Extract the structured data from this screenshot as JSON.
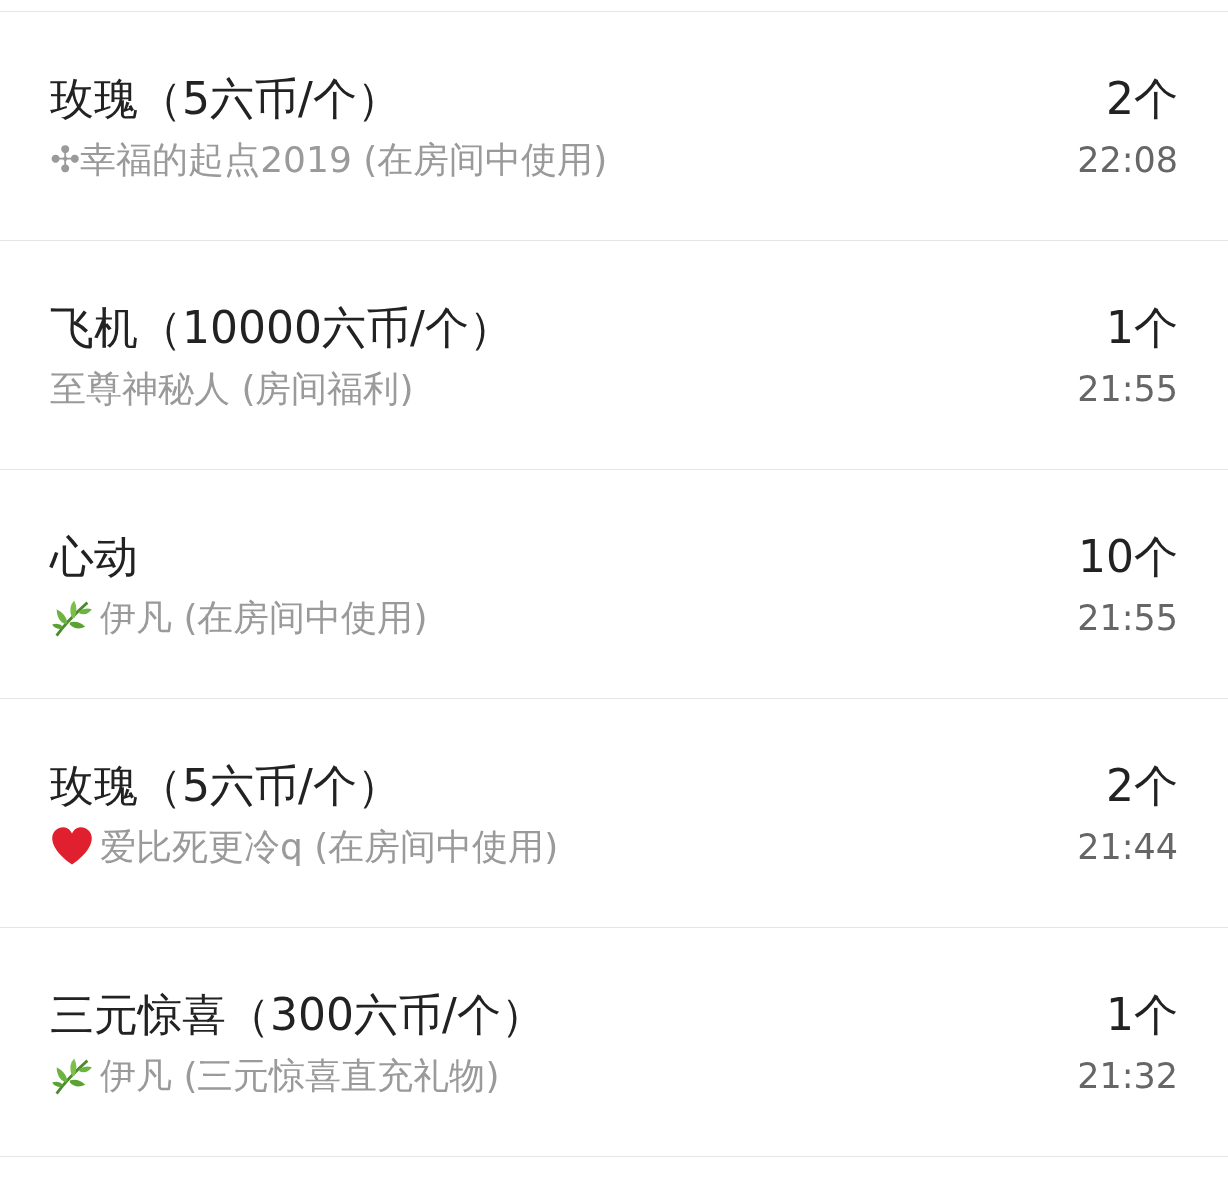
{
  "records": [
    {
      "gift": "玫瑰（5六币/个）",
      "kind": "plain",
      "sender": "✣幸福的起点2019 (在房间中使用)",
      "count": "2个",
      "time": "22:08"
    },
    {
      "gift": "飞机（10000六币/个）",
      "kind": "plain",
      "sender": "至尊神秘人 (房间福利)",
      "count": "1个",
      "time": "21:55"
    },
    {
      "gift": "心动",
      "kind": "leaf",
      "sender": "伊凡 (在房间中使用)",
      "count": "10个",
      "time": "21:55"
    },
    {
      "gift": "玫瑰（5六币/个）",
      "kind": "heart",
      "sender": "爱比死更冷q (在房间中使用)",
      "count": "2个",
      "time": "21:44"
    },
    {
      "gift": "三元惊喜（300六币/个）",
      "kind": "leaf",
      "sender": "伊凡 (三元惊喜直充礼物)",
      "count": "1个",
      "time": "21:32"
    }
  ]
}
